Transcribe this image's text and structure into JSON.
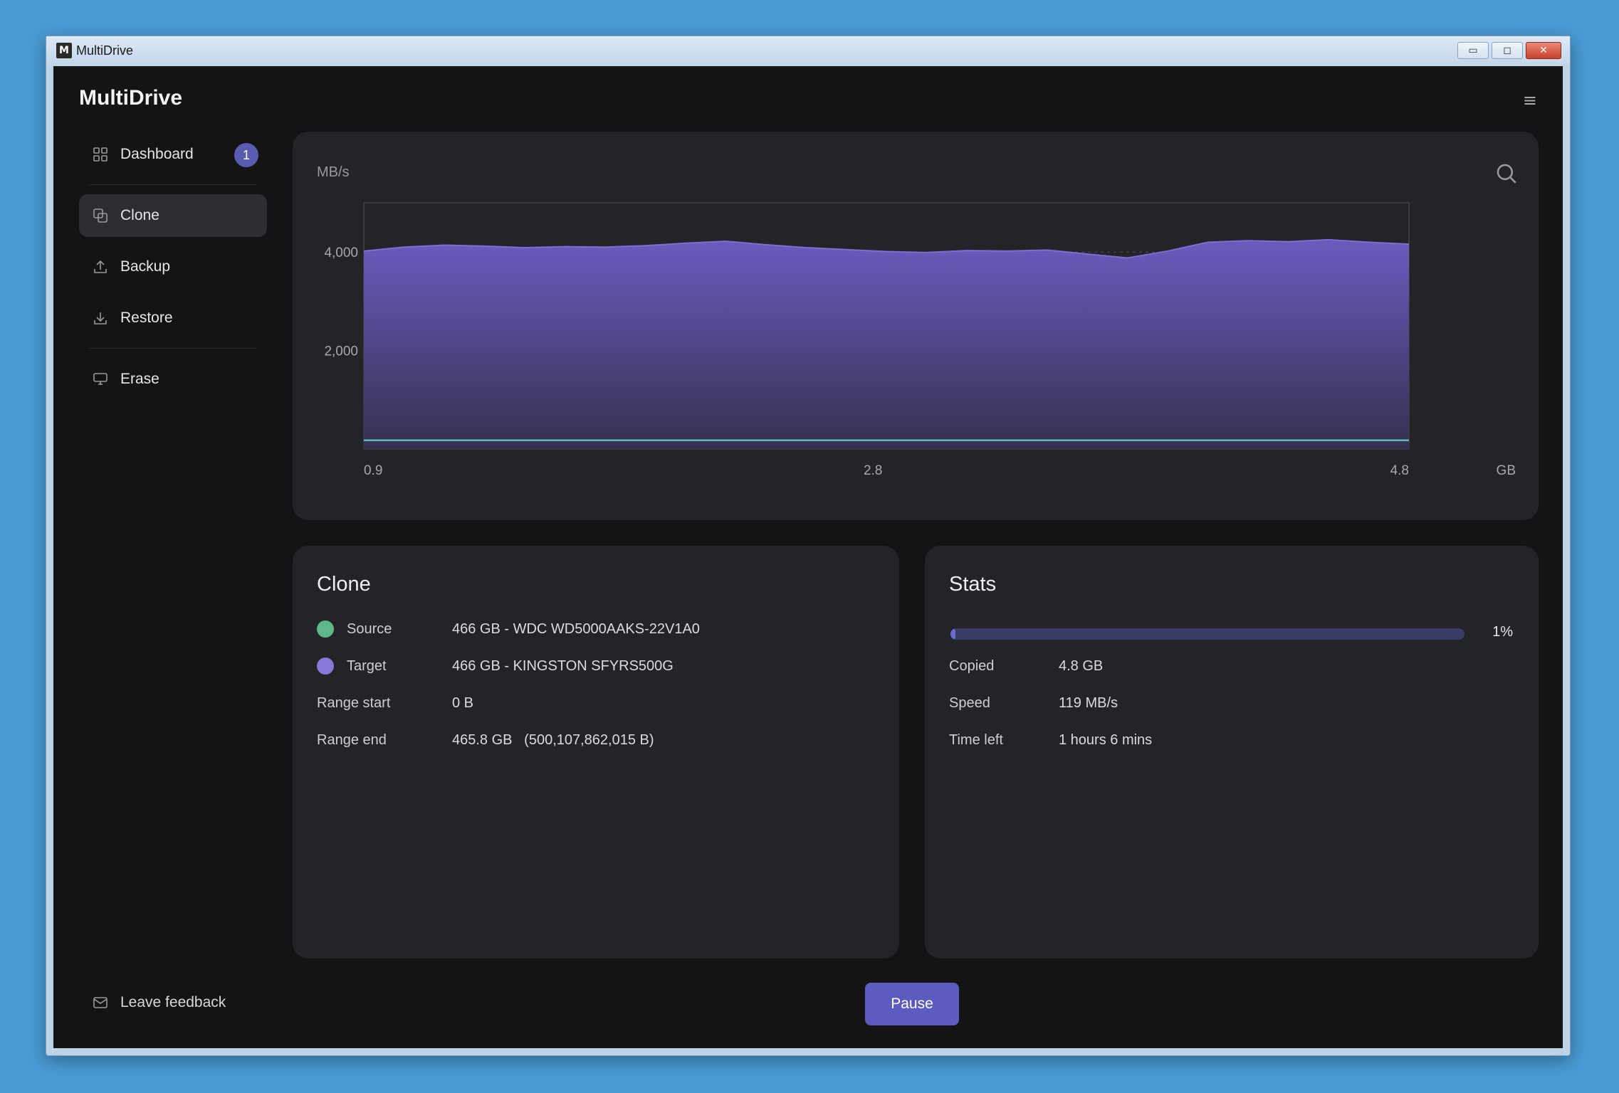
{
  "window": {
    "title": "MultiDrive",
    "controls": {
      "minimize": "▭",
      "maximize": "◻",
      "close": "✕"
    }
  },
  "app": {
    "brand": "MultiDrive",
    "menu_icon": "≡"
  },
  "sidebar": {
    "items": [
      {
        "label": "Dashboard",
        "icon": "grid-icon",
        "badge": "1"
      },
      {
        "label": "Clone",
        "icon": "copy-icon",
        "active": true
      },
      {
        "label": "Backup",
        "icon": "upload-icon"
      },
      {
        "label": "Restore",
        "icon": "download-icon"
      },
      {
        "label": "Erase",
        "icon": "monitor-icon"
      }
    ],
    "feedback_label": "Leave feedback"
  },
  "chart_data": {
    "type": "area",
    "ylabel": "MB/s",
    "xunit": "GB",
    "xlim": [
      0.9,
      4.8
    ],
    "ylim": [
      0,
      5000
    ],
    "x_ticks": [
      "0.9",
      "2.8",
      "4.8"
    ],
    "y_ticks": [
      "4,000",
      "2,000"
    ],
    "grid": "horizontal-dashed",
    "series": [
      {
        "color": "#6b5bbf",
        "x": [
          0.9,
          1.05,
          1.2,
          1.35,
          1.5,
          1.65,
          1.8,
          1.95,
          2.1,
          2.25,
          2.4,
          2.55,
          2.7,
          2.85,
          3.0,
          3.15,
          3.3,
          3.45,
          3.6,
          3.75,
          3.9,
          4.05,
          4.2,
          4.35,
          4.5,
          4.65,
          4.8
        ],
        "values": [
          4020,
          4100,
          4140,
          4120,
          4090,
          4110,
          4100,
          4130,
          4180,
          4220,
          4150,
          4090,
          4050,
          4010,
          3990,
          4030,
          4020,
          4040,
          3960,
          3880,
          4020,
          4200,
          4230,
          4210,
          4250,
          4200,
          4160
        ]
      },
      {
        "color": "#5fb8b8",
        "x": [
          0.9,
          4.8
        ],
        "values": [
          119,
          119
        ]
      }
    ]
  },
  "clone": {
    "title": "Clone",
    "source_label": "Source",
    "source_value": "466 GB - WDC WD5000AAKS-22V1A0",
    "source_color": "#5fb88a",
    "target_label": "Target",
    "target_value": "466 GB - KINGSTON SFYRS500G",
    "target_color": "#8a78d8",
    "range_start_label": "Range start",
    "range_start_value": "0 B",
    "range_end_label": "Range end",
    "range_end_value": "465.8 GB   (500,107,862,015 B)"
  },
  "stats": {
    "title": "Stats",
    "progress_percent": 1,
    "progress_label": "1%",
    "copied_label": "Copied",
    "copied_value": "4.8 GB",
    "speed_label": "Speed",
    "speed_value": "119 MB/s",
    "time_left_label": "Time left",
    "time_left_value": "1 hours 6 mins"
  },
  "actions": {
    "pause_label": "Pause"
  }
}
